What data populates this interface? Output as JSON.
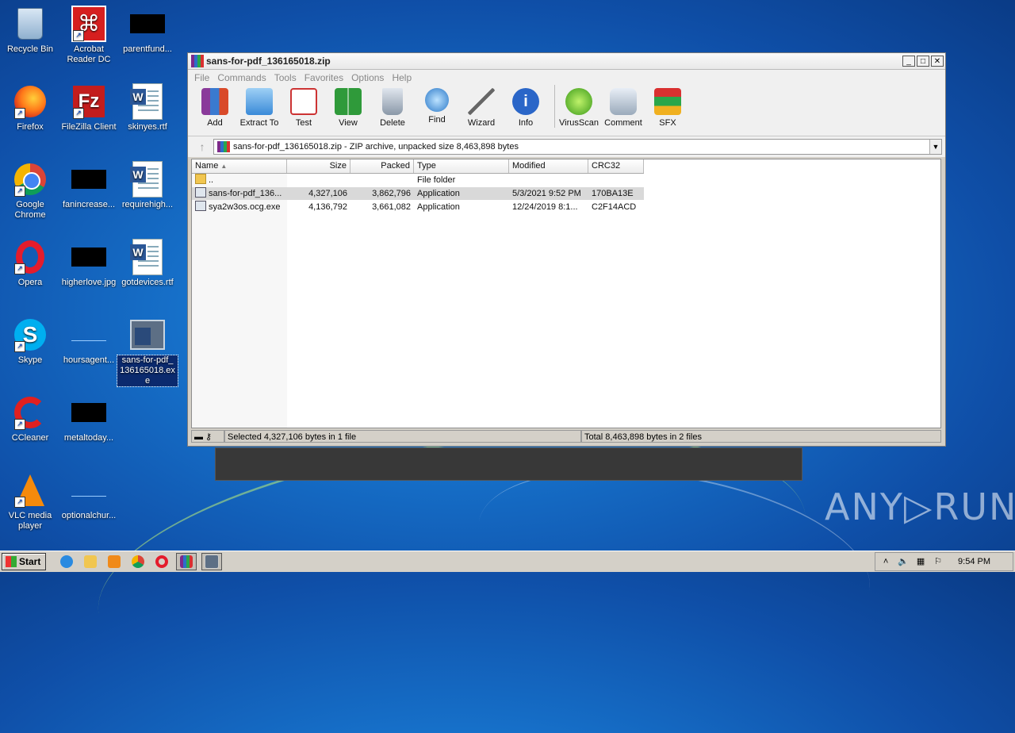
{
  "desktop": {
    "icons": [
      {
        "label": "Recycle Bin"
      },
      {
        "label": "Acrobat\nReader DC"
      },
      {
        "label": "parentfund..."
      },
      {
        "label": "Firefox"
      },
      {
        "label": "FileZilla Client"
      },
      {
        "label": "skinyes.rtf"
      },
      {
        "label": "Google\nChrome"
      },
      {
        "label": "fanincrease..."
      },
      {
        "label": "requirehigh..."
      },
      {
        "label": "Opera"
      },
      {
        "label": "higherlove.jpg"
      },
      {
        "label": "gotdevices.rtf"
      },
      {
        "label": "Skype"
      },
      {
        "label": "hoursagent..."
      },
      {
        "label": "sans-for-pdf_\n136165018.ex\ne"
      },
      {
        "label": "CCleaner"
      },
      {
        "label": "metaltoday..."
      },
      {
        "label": "VLC media\nplayer"
      },
      {
        "label": "optionalchur..."
      }
    ],
    "watermark": "ANY▷RUN"
  },
  "window": {
    "title": "sans-for-pdf_136165018.zip",
    "menu": [
      "File",
      "Commands",
      "Tools",
      "Favorites",
      "Options",
      "Help"
    ],
    "toolbar": [
      "Add",
      "Extract To",
      "Test",
      "View",
      "Delete",
      "Find",
      "Wizard",
      "Info",
      "VirusScan",
      "Comment",
      "SFX"
    ],
    "address": "sans-for-pdf_136165018.zip - ZIP archive, unpacked size 8,463,898 bytes",
    "columns": [
      "Name",
      "Size",
      "Packed",
      "Type",
      "Modified",
      "CRC32"
    ],
    "rows": [
      {
        "name": "..",
        "size": "",
        "packed": "",
        "type": "File folder",
        "modified": "",
        "crc": ""
      },
      {
        "name": "sans-for-pdf_136...",
        "size": "4,327,106",
        "packed": "3,862,796",
        "type": "Application",
        "modified": "5/3/2021 9:52 PM",
        "crc": "170BA13E"
      },
      {
        "name": "sya2w3os.ocg.exe",
        "size": "4,136,792",
        "packed": "3,661,082",
        "type": "Application",
        "modified": "12/24/2019 8:1...",
        "crc": "C2F14ACD"
      }
    ],
    "status_left": "Selected 4,327,106 bytes in 1 file",
    "status_right": "Total 8,463,898 bytes in 2 files"
  },
  "taskbar": {
    "start_label": "Start",
    "clock": "9:54 PM"
  },
  "colors": {
    "desktop_blue": "#1670c9",
    "selection_gray": "#d9d9d9",
    "window_face": "#d4d0c8"
  }
}
